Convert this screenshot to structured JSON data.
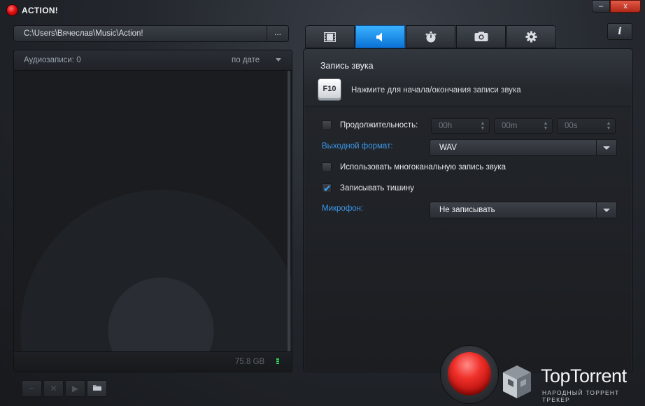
{
  "window": {
    "title": "ACTION!",
    "minimize_label": "–",
    "close_label": "x"
  },
  "path_bar": {
    "path": "C:\\Users\\Вячеслав\\Music\\Action!",
    "browse_label": "..."
  },
  "recordings_panel": {
    "count_label": "Аудиозаписи: 0",
    "sort_label": "по дате",
    "disk_space": "75.8 GB"
  },
  "toolbar": {
    "buttons": [
      {
        "icon": "minus-icon",
        "glyph": "−"
      },
      {
        "icon": "delete-icon",
        "glyph": "✕"
      },
      {
        "icon": "play-icon",
        "glyph": "▶"
      },
      {
        "icon": "folder-icon",
        "glyph": "📂"
      }
    ]
  },
  "tabs": [
    {
      "icon": "film-icon",
      "active": false
    },
    {
      "icon": "speaker-icon",
      "active": true
    },
    {
      "icon": "stopwatch-icon",
      "active": false
    },
    {
      "icon": "camera-icon",
      "active": false
    },
    {
      "icon": "gear-icon",
      "active": false
    }
  ],
  "info_button": {
    "label": "i"
  },
  "audio_settings": {
    "title": "Запись звука",
    "hotkey": "F10",
    "hotkey_hint": "Нажмите для начала/окончания записи звука",
    "duration": {
      "label": "Продолжительность:",
      "checked": false,
      "hours": "00h",
      "minutes": "00m",
      "seconds": "00s"
    },
    "output_format": {
      "label": "Выходной формат:",
      "value": "WAV"
    },
    "multichannel": {
      "label": "Использовать многоканальную запись звука",
      "checked": false
    },
    "record_silence": {
      "label": "Записывать тишину",
      "checked": true
    },
    "microphone": {
      "label": "Микрофон:",
      "value": "Не записывать"
    }
  },
  "colors": {
    "accent": "#1a8cf0",
    "record": "#e3221c",
    "link_label": "#3c97e8",
    "disk_meter": "#2fd05a"
  },
  "watermark": {
    "title": "TopTorrent",
    "subtitle": "НАРОДНЫЙ ТОРРЕНТ ТРЕКЕР"
  }
}
